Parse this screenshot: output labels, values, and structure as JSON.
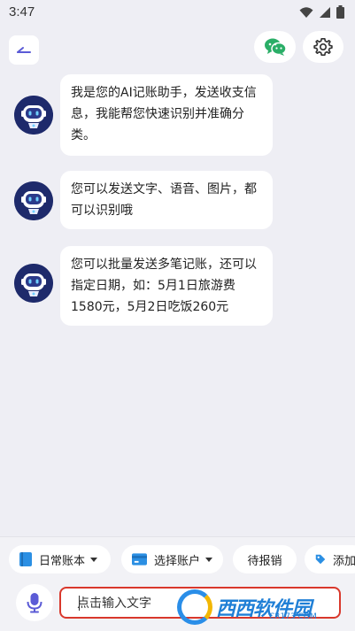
{
  "status_bar": {
    "time": "3:47",
    "icons": [
      "wifi-icon",
      "signal-icon",
      "battery-icon"
    ]
  },
  "header": {
    "back_icon": "back-arrow-icon",
    "wechat_icon": "wechat-icon",
    "settings_icon": "gear-icon"
  },
  "messages": [
    {
      "avatar": "robot-avatar",
      "text": "我是您的AI记账助手，发送收支信息，我能帮您快速识别并准确分类。"
    },
    {
      "avatar": "robot-avatar",
      "text": "您可以发送文字、语音、图片，都可以识别哦"
    },
    {
      "avatar": "robot-avatar",
      "text": "您可以批量发送多笔记账，还可以指定日期，如：5月1日旅游费1580元，5月2日吃饭260元"
    }
  ],
  "toolbar": {
    "account_book": "日常账本",
    "select_account": "选择账户",
    "pending_reimburse": "待报销",
    "add_tag": "添加"
  },
  "input": {
    "placeholder": "点击输入文字"
  },
  "watermark": {
    "text_a": "西西",
    "text_b": "软件园",
    "sub": "CR173.COM"
  },
  "colors": {
    "accent": "#5b5bd6",
    "wechat": "#2aae67",
    "input_border": "#d9382c",
    "avatar_bg": "#1e2a6b"
  }
}
